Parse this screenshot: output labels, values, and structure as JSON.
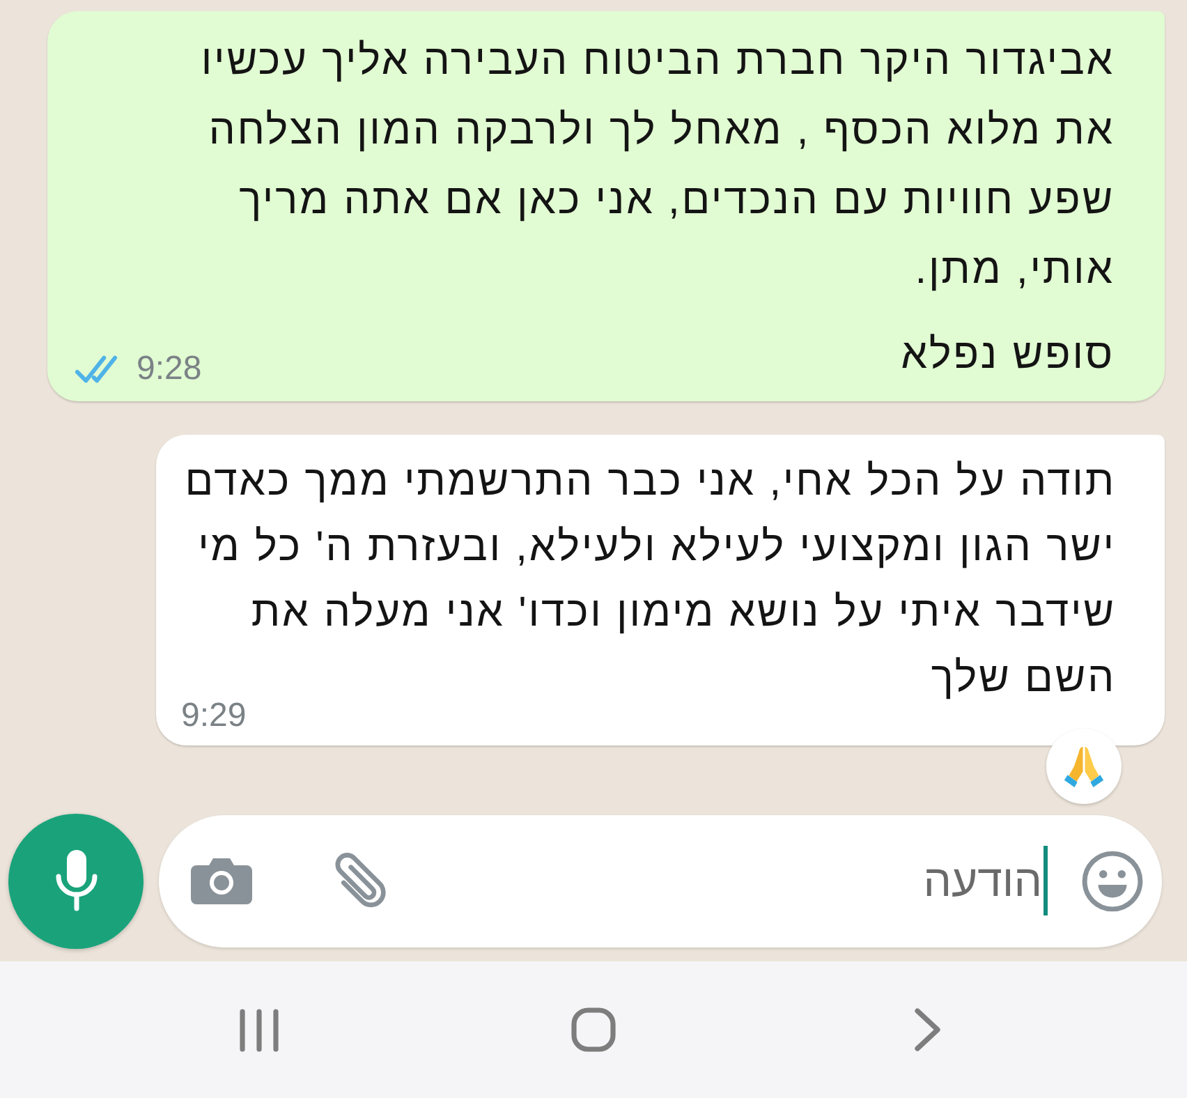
{
  "messages": [
    {
      "kind": "outgoing",
      "paragraphs": [
        [
          "אביגדור היקר חברת הביטוח העבירה אליך עכשיו",
          "את מלוא הכסף , מאחל לך ולרבקה המון הצלחה",
          "שפע חוויות עם הנכדים, אני כאן אם אתה מריך",
          "אותי, מתן."
        ],
        [
          "סופש נפלא"
        ]
      ],
      "time": "9:28",
      "read": true,
      "reacted": false
    },
    {
      "kind": "incoming",
      "paragraphs": [
        [
          "תודה על הכל אחי, אני כבר התרשמתי ממך כאדם",
          "ישר הגון ומקצועי לעילא ולעילא, ובעזרת ה' כל מי",
          "שידבר איתי על נושא מימון וכדו' אני מעלה את",
          "השם שלך"
        ]
      ],
      "time": "9:29",
      "reacted": true
    }
  ],
  "composer": {
    "placeholder": "הודעה"
  }
}
